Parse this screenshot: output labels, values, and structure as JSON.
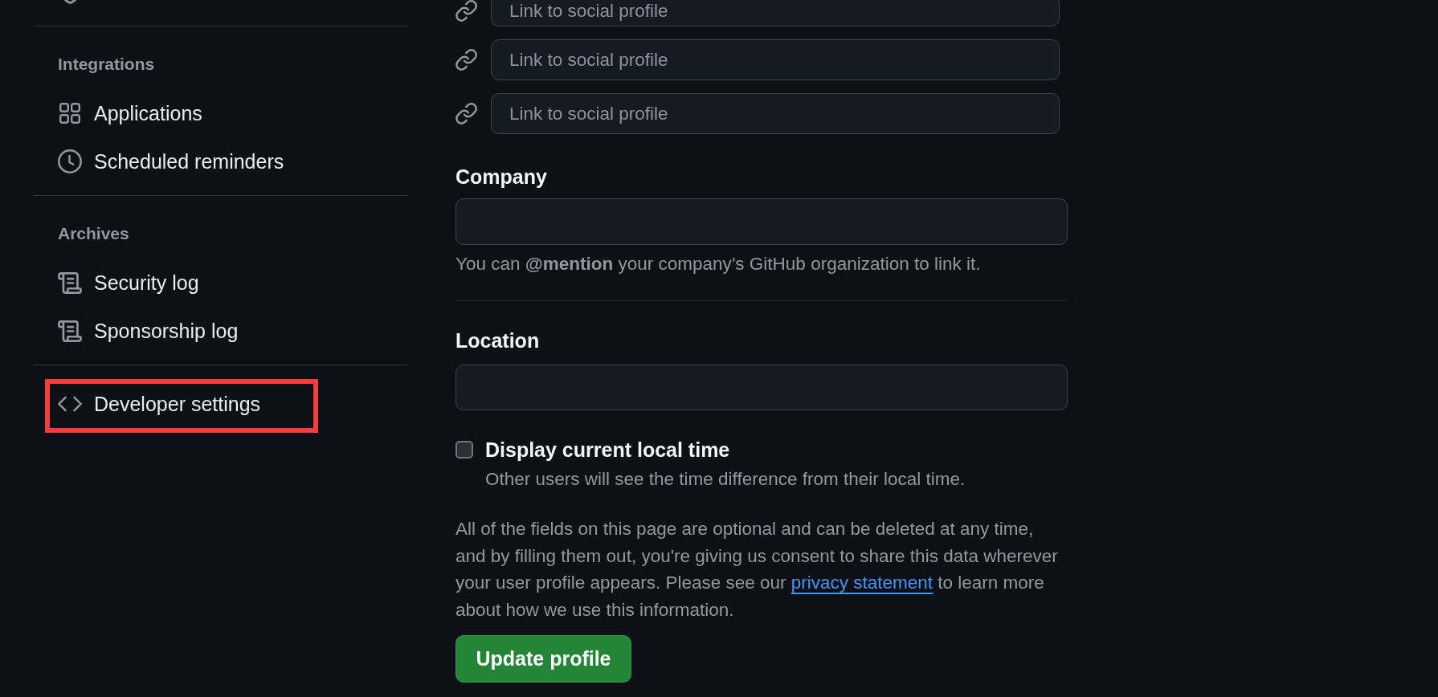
{
  "sidebar": {
    "sections": [
      {
        "items": [
          {
            "highlighted": false
          }
        ]
      },
      {
        "heading": "Integrations",
        "items": [
          {
            "label": "Applications",
            "highlighted": false
          },
          {
            "label": "Scheduled reminders",
            "highlighted": false
          }
        ]
      },
      {
        "heading": "Archives",
        "items": [
          {
            "label": "Security log",
            "highlighted": false
          },
          {
            "label": "Sponsorship log",
            "highlighted": false
          }
        ]
      },
      {
        "items": [
          {
            "label": "Developer settings",
            "highlighted": true
          }
        ]
      }
    ]
  },
  "social_links": [
    {
      "placeholder": "Link to social profile"
    },
    {
      "placeholder": "Link to social profile"
    },
    {
      "placeholder": "Link to social profile"
    }
  ],
  "company": {
    "label": "Company",
    "hint": "You can **@mention** your company’s GitHub organization to link it."
  },
  "location": {
    "label": "Location"
  },
  "local_time": {
    "label": "Display current local time",
    "checked": false,
    "description": "Other users will see the time difference from their local time."
  },
  "notice": {
    "text_before": "All of the fields on this page are optional and can be deleted at any time, and by filling them out, you're giving us consent to share this data wherever your user profile appears. Please see our ",
    "link": "privacy statement",
    "text_after": " to learn more about how we use this information."
  },
  "submit_button": "Update profile"
}
